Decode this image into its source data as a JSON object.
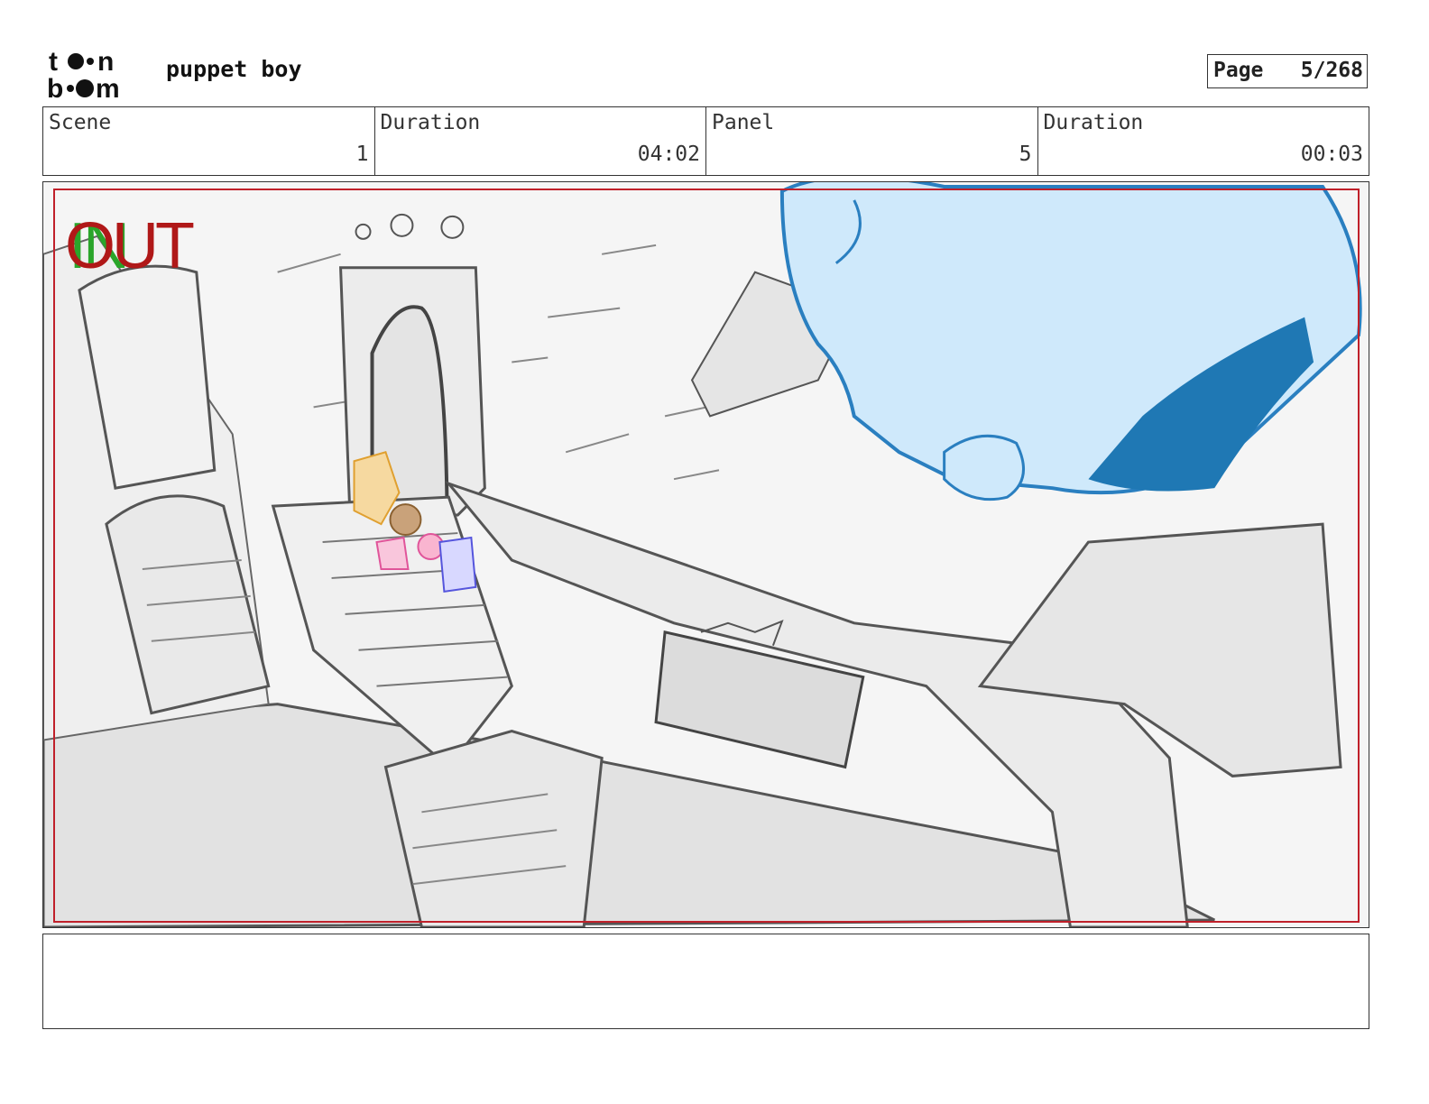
{
  "header": {
    "logo_text": "toon boom",
    "project_title": "puppet boy",
    "page_label": "Page",
    "page_value": "5/268"
  },
  "info": [
    {
      "label": "Scene",
      "value": "1"
    },
    {
      "label": "Duration",
      "value": "04:02"
    },
    {
      "label": "Panel",
      "value": "5"
    },
    {
      "label": "Duration",
      "value": "00:03"
    }
  ],
  "panel": {
    "in_marker": "IN",
    "out_marker": "OUT",
    "colors": {
      "safe_frame": "#c0202a",
      "in_marker": "#2aa52a",
      "out_marker": "#b01818",
      "character_blue": "#cfe9fb",
      "character_outline": "#2a7fc0",
      "character_shadow": "#1f78b4"
    }
  },
  "notes": {
    "text": ""
  }
}
